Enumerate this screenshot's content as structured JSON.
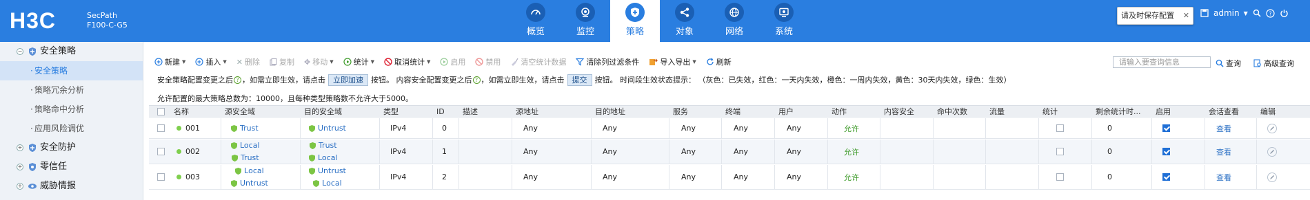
{
  "header": {
    "logo": "H3C",
    "model_line1": "SecPath",
    "model_line2": "F100-C-G5",
    "nav": [
      {
        "label": "概览",
        "icon": "dashboard-icon"
      },
      {
        "label": "监控",
        "icon": "monitor-icon"
      },
      {
        "label": "策略",
        "icon": "shield-plus-icon",
        "active": true
      },
      {
        "label": "对象",
        "icon": "share-icon"
      },
      {
        "label": "网络",
        "icon": "globe-icon"
      },
      {
        "label": "系统",
        "icon": "system-icon"
      }
    ],
    "save_tip": "请及时保存配置",
    "user": "admin"
  },
  "sidebar": {
    "groups": [
      {
        "label": "安全策略",
        "icon": "shield-icon",
        "toggle": "−"
      },
      {
        "label": "安全防护",
        "icon": "shield-icon",
        "toggle": "+"
      },
      {
        "label": "零信任",
        "icon": "shield-icon",
        "toggle": "+"
      },
      {
        "label": "威胁情报",
        "icon": "eye-icon",
        "toggle": "+"
      }
    ],
    "subitems": [
      "安全策略",
      "策略冗余分析",
      "策略命中分析",
      "应用风险调优"
    ]
  },
  "toolbar": {
    "new": "新建",
    "insert": "插入",
    "delete": "删除",
    "copy": "复制",
    "move": "移动",
    "stats": "统计",
    "cancel_stats": "取消统计",
    "enable": "启用",
    "disable": "禁用",
    "clear_stats": "清空统计数据",
    "clear_filter": "清除列过滤条件",
    "import_export": "导入导出",
    "refresh": "刷新",
    "search_placeholder": "请输入要查询信息",
    "search": "查询",
    "advanced": "高级查询"
  },
  "hints": {
    "p1": "安全策略配置变更之后",
    "p2": "，如需立即生效，请点击",
    "btn_apply": "立即加速",
    "p3": "按钮。 内容安全配置变更之后",
    "p4": "，如需立即生效，请点击",
    "btn_submit": "提交",
    "p5": "按钮。 时间段生效状态提示：  （灰色：已失效，红色：一天内失效，橙色：一周内失效，黄色：30天内失效，绿色：生效）",
    "limit": "允许配置的最大策略总数为：10000，且每种类型策略数不允许大于5000。"
  },
  "table": {
    "columns": [
      "名称",
      "源安全域",
      "目的安全域",
      "类型",
      "ID",
      "描述",
      "源地址",
      "目的地址",
      "服务",
      "终端",
      "用户",
      "动作",
      "内容安全",
      "命中次数",
      "流量",
      "统计",
      "剩余统计时...",
      "启用",
      "会话查看",
      "编辑"
    ],
    "rows": [
      {
        "name": "001",
        "src_zone": [
          "Trust"
        ],
        "dst_zone": [
          "Untrust"
        ],
        "type": "IPv4",
        "id": "0",
        "src_addr": "Any",
        "dst_addr": "Any",
        "service": "Any",
        "terminal": "Any",
        "user": "Any",
        "action": "允许",
        "remaining": "0",
        "enabled": true,
        "view": "查看"
      },
      {
        "name": "002",
        "src_zone": [
          "Local",
          "Trust"
        ],
        "dst_zone": [
          "Trust",
          "Local"
        ],
        "type": "IPv4",
        "id": "1",
        "src_addr": "Any",
        "dst_addr": "Any",
        "service": "Any",
        "terminal": "Any",
        "user": "Any",
        "action": "允许",
        "remaining": "0",
        "enabled": true,
        "view": "查看"
      },
      {
        "name": "003",
        "src_zone": [
          "Local",
          "Untrust"
        ],
        "dst_zone": [
          "Untrust",
          "Local"
        ],
        "type": "IPv4",
        "id": "2",
        "src_addr": "Any",
        "dst_addr": "Any",
        "service": "Any",
        "terminal": "Any",
        "user": "Any",
        "action": "允许",
        "remaining": "0",
        "enabled": true,
        "view": "查看"
      }
    ]
  },
  "colors": {
    "header_bg": "#2a7ee0",
    "allow": "#3e9b2a",
    "link": "#2a6fc4",
    "status_dot": "#7fcf4d"
  }
}
